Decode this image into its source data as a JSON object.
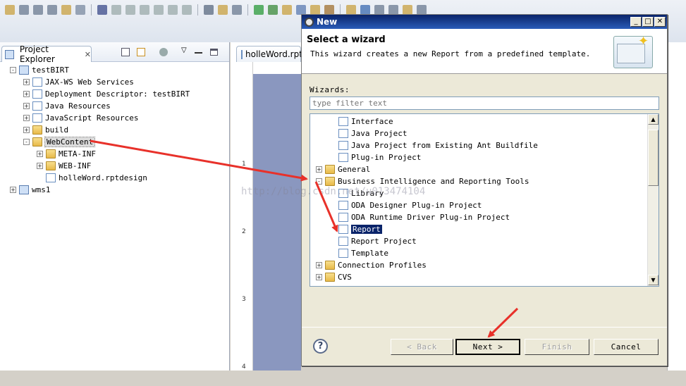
{
  "explorer": {
    "tab_label": "Project Explorer",
    "tree": [
      {
        "label": "testBIRT",
        "depth": 0,
        "expander": "-",
        "icon": "project-icon"
      },
      {
        "label": "JAX-WS Web Services",
        "depth": 1,
        "expander": "+",
        "icon": "webservice-icon"
      },
      {
        "label": "Deployment Descriptor: testBIRT",
        "depth": 1,
        "expander": "+",
        "icon": "descriptor-icon"
      },
      {
        "label": "Java Resources",
        "depth": 1,
        "expander": "+",
        "icon": "java-resources-icon"
      },
      {
        "label": "JavaScript Resources",
        "depth": 1,
        "expander": "+",
        "icon": "javascript-icon"
      },
      {
        "label": "build",
        "depth": 1,
        "expander": "+",
        "icon": "folder-icon"
      },
      {
        "label": "WebContent",
        "depth": 1,
        "expander": "-",
        "icon": "folder-open-icon",
        "selected": true
      },
      {
        "label": "META-INF",
        "depth": 2,
        "expander": "+",
        "icon": "folder-icon"
      },
      {
        "label": "WEB-INF",
        "depth": 2,
        "expander": "+",
        "icon": "folder-icon"
      },
      {
        "label": "holleWord.rptdesign",
        "depth": 2,
        "expander": "",
        "icon": "rptdesign-file-icon"
      },
      {
        "label": "wms1",
        "depth": 0,
        "expander": "+",
        "icon": "project-icon"
      }
    ]
  },
  "editor": {
    "tab_label": "holleWord.rpt",
    "ruler_numbers": [
      "1",
      "2",
      "3",
      "4"
    ]
  },
  "dialog": {
    "title": "New",
    "banner_heading": "Select a wizard",
    "banner_description": "This wizard creates a new Report from a predefined template.",
    "wizards_label": "Wizards:",
    "filter_placeholder": "type filter text",
    "wizard_list": [
      {
        "label": "Interface",
        "depth": 1,
        "expander": "",
        "icon": "interface-icon"
      },
      {
        "label": "Java Project",
        "depth": 1,
        "expander": "",
        "icon": "java-project-icon"
      },
      {
        "label": "Java Project from Existing Ant Buildfile",
        "depth": 1,
        "expander": "",
        "icon": "ant-icon"
      },
      {
        "label": "Plug-in Project",
        "depth": 1,
        "expander": "",
        "icon": "plugin-icon"
      },
      {
        "label": "General",
        "depth": 0,
        "expander": "+",
        "icon": "folder-icon"
      },
      {
        "label": "Business Intelligence and Reporting Tools",
        "depth": 0,
        "expander": "-",
        "icon": "folder-open-icon"
      },
      {
        "label": "Library",
        "depth": 1,
        "expander": "",
        "icon": "library-icon"
      },
      {
        "label": "ODA Designer Plug-in Project",
        "depth": 1,
        "expander": "",
        "icon": "oda-icon"
      },
      {
        "label": "ODA Runtime Driver Plug-in Project",
        "depth": 1,
        "expander": "",
        "icon": "oda-icon"
      },
      {
        "label": "Report",
        "depth": 1,
        "expander": "",
        "icon": "report-icon",
        "selected": true
      },
      {
        "label": "Report Project",
        "depth": 1,
        "expander": "",
        "icon": "report-project-icon"
      },
      {
        "label": "Template",
        "depth": 1,
        "expander": "",
        "icon": "template-icon"
      },
      {
        "label": "Connection Profiles",
        "depth": 0,
        "expander": "+",
        "icon": "folder-icon"
      },
      {
        "label": "CVS",
        "depth": 0,
        "expander": "+",
        "icon": "folder-icon"
      }
    ],
    "buttons": {
      "back": "< Back",
      "next": "Next >",
      "finish": "Finish",
      "cancel": "Cancel"
    }
  },
  "watermark": "http://blog.csdn.net/u013474104",
  "colors": {
    "selection": "#0a246a",
    "annotation_arrow": "#e8312a"
  }
}
